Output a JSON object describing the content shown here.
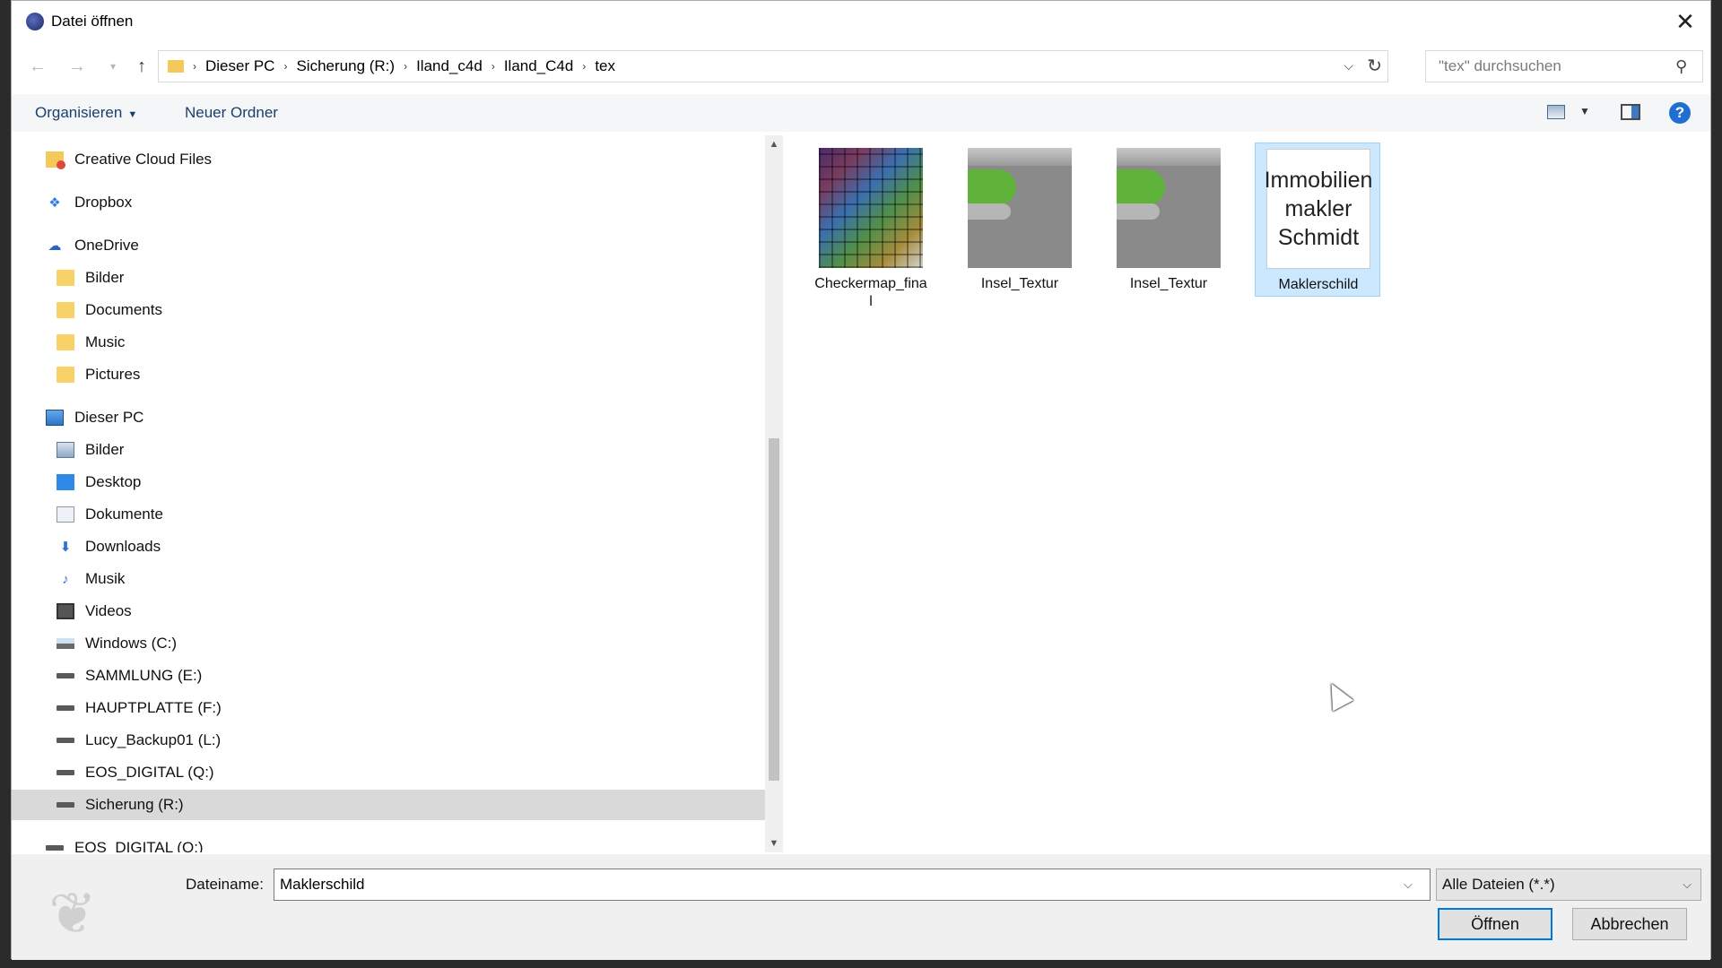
{
  "window": {
    "title": "Datei öffnen",
    "close_glyph": "✕"
  },
  "address": {
    "crumbs": [
      "Dieser PC",
      "Sicherung (R:)",
      "Iland_c4d",
      "Iland_C4d",
      "tex"
    ],
    "search_placeholder": "\"tex\" durchsuchen"
  },
  "toolbar": {
    "organize": "Organisieren",
    "new_folder": "Neuer Ordner",
    "help": "?"
  },
  "nav_tree": [
    {
      "label": "Creative Cloud Files",
      "icon": "creative-cloud-icon",
      "level": 0
    },
    {
      "label": "Dropbox",
      "icon": "dropbox-icon",
      "level": 0
    },
    {
      "label": "OneDrive",
      "icon": "onedrive-icon",
      "level": 0
    },
    {
      "label": "Bilder",
      "icon": "folder-icon",
      "level": 1
    },
    {
      "label": "Documents",
      "icon": "folder-icon",
      "level": 1
    },
    {
      "label": "Music",
      "icon": "folder-icon",
      "level": 1
    },
    {
      "label": "Pictures",
      "icon": "folder-icon",
      "level": 1
    },
    {
      "label": "Dieser PC",
      "icon": "computer-icon",
      "level": 0
    },
    {
      "label": "Bilder",
      "icon": "pictures-icon",
      "level": 1
    },
    {
      "label": "Desktop",
      "icon": "desktop-icon",
      "level": 1
    },
    {
      "label": "Dokumente",
      "icon": "documents-icon",
      "level": 1
    },
    {
      "label": "Downloads",
      "icon": "downloads-icon",
      "level": 1
    },
    {
      "label": "Musik",
      "icon": "music-icon",
      "level": 1
    },
    {
      "label": "Videos",
      "icon": "videos-icon",
      "level": 1
    },
    {
      "label": "Windows (C:)",
      "icon": "windows-drive-icon",
      "level": 1
    },
    {
      "label": "SAMMLUNG (E:)",
      "icon": "drive-icon",
      "level": 1
    },
    {
      "label": "HAUPTPLATTE (F:)",
      "icon": "drive-icon",
      "level": 1
    },
    {
      "label": "Lucy_Backup01 (L:)",
      "icon": "drive-icon",
      "level": 1
    },
    {
      "label": "EOS_DIGITAL (Q:)",
      "icon": "drive-icon",
      "level": 1
    },
    {
      "label": "Sicherung (R:)",
      "icon": "drive-icon",
      "level": 1,
      "selected": true
    },
    {
      "label": "EOS_DIGITAL (Q:)",
      "icon": "drive-icon",
      "level": 0
    }
  ],
  "files": [
    {
      "name": "Checkermap_final",
      "name_line1": "Checkermap_fina",
      "name_line2": "l",
      "thumb": "checker"
    },
    {
      "name": "Insel_Textur",
      "name_line1": "Insel_Textur",
      "name_line2": "",
      "thumb": "insel"
    },
    {
      "name": "Insel_Textur",
      "name_line1": "Insel_Textur",
      "name_line2": "",
      "thumb": "insel"
    },
    {
      "name": "Maklerschild",
      "name_line1": "Maklerschild",
      "name_line2": "",
      "thumb": "sign",
      "selected": true
    }
  ],
  "sign_thumbnail": {
    "lines": [
      "Immobilien",
      "makler",
      "Schmidt"
    ]
  },
  "bottom": {
    "filename_label": "Dateiname:",
    "filename_value": "Maklerschild",
    "filter_value": "Alle Dateien (*.*)",
    "open_label": "Öffnen",
    "cancel_label": "Abbrechen"
  },
  "colors": {
    "accent": "#0078d7",
    "selection": "#cce8ff",
    "link_text": "#1a3f6e"
  }
}
